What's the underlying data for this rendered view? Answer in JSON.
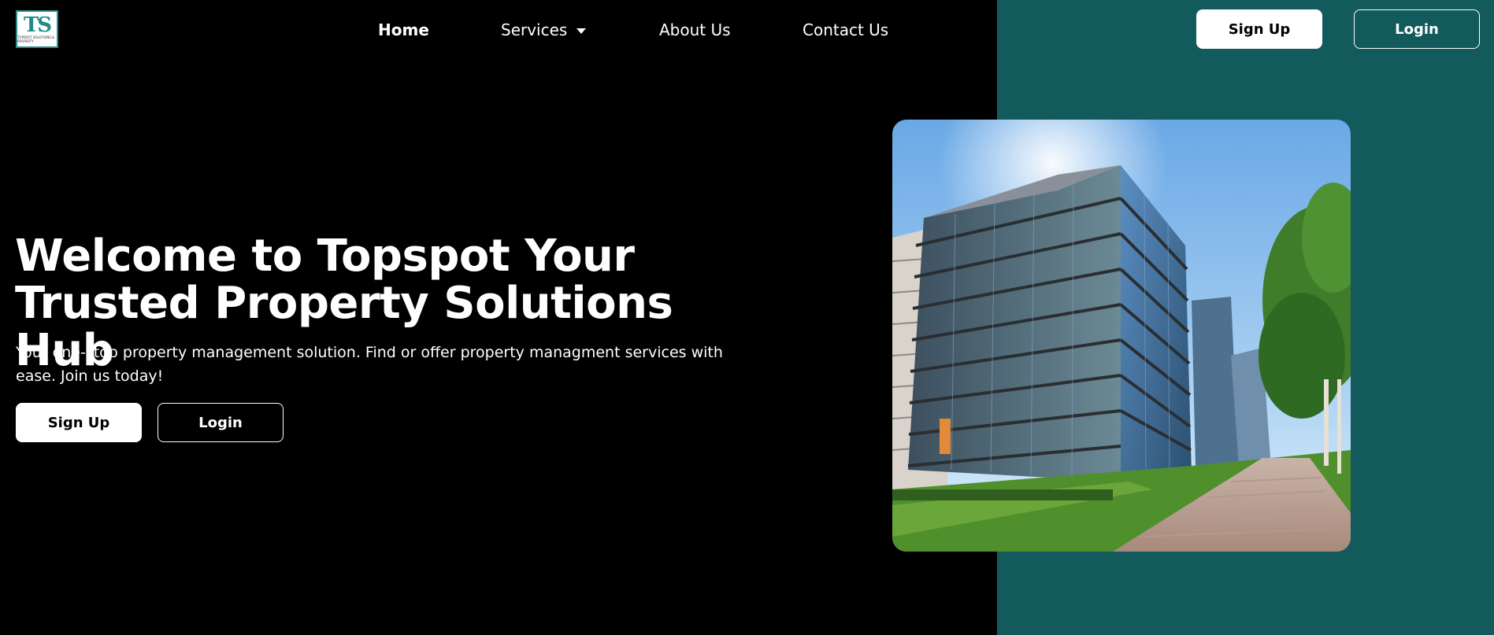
{
  "brand": {
    "logo_mark": "TS",
    "logo_tagline": "TOPSPOT SOLUTIONS & PROPERTY"
  },
  "nav": {
    "home": "Home",
    "services": "Services",
    "about": "About Us",
    "contact": "Contact Us"
  },
  "header_actions": {
    "signup": "Sign Up",
    "login": "Login"
  },
  "hero": {
    "title": "Welcome to Topspot Your Trusted Property Solutions Hub",
    "subtitle": "Your one-stop property management solution. Find or offer property managment services with ease. Join us today!",
    "signup": "Sign Up",
    "login": "Login"
  },
  "colors": {
    "background": "#000000",
    "accent_panel": "#125a5c",
    "button_light": "#ffffff"
  },
  "icons": {
    "services_dropdown": "chevron-down-icon",
    "hero_image": "office-building-photo"
  }
}
